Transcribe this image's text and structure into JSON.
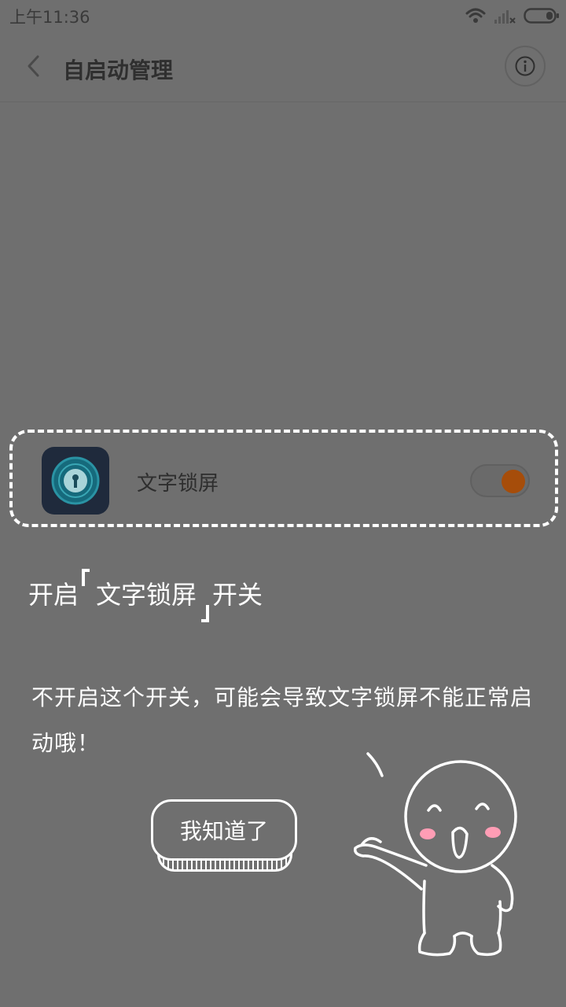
{
  "status_bar": {
    "time": "上午11:36"
  },
  "header": {
    "title": "自启动管理"
  },
  "app_row": {
    "name": "文字锁屏",
    "toggle_on": true
  },
  "instructions": {
    "title_prefix": "开启",
    "title_app": "文字锁屏",
    "title_suffix": "开关",
    "body": "不开启这个开关，可能会导致文字锁屏不能正常启动哦！"
  },
  "ok_button": {
    "label": "我知道了"
  },
  "colors": {
    "overlay": "#6f6f6f",
    "toggle_knob": "#a64d0a",
    "outline": "#ffffff"
  }
}
